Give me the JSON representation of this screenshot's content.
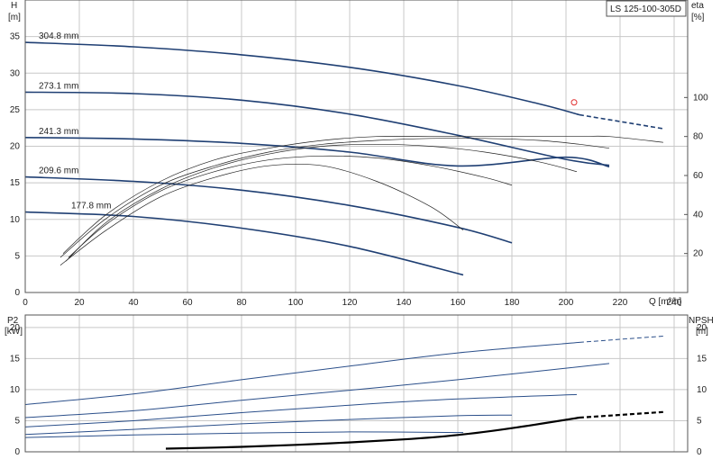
{
  "model_label": "LS 125-100-305D",
  "top_chart": {
    "y_left_label_1": "H",
    "y_left_label_2": "[m]",
    "y_right_label_1": "eta",
    "y_right_label_2": "[%]",
    "x_axis_unit": "Q [m³/h]",
    "x_ticks": [
      "0",
      "20",
      "40",
      "60",
      "80",
      "100",
      "120",
      "140",
      "160",
      "180",
      "200",
      "220",
      "240"
    ],
    "y_left_ticks": [
      "0",
      "5",
      "10",
      "15",
      "20",
      "25",
      "30",
      "35"
    ],
    "y_right_ticks": [
      "20",
      "40",
      "60",
      "80",
      "100"
    ]
  },
  "bottom_chart": {
    "y_left_label_1": "P2",
    "y_left_label_2": "[kW]",
    "y_right_label_1": "NPSH",
    "y_right_label_2": "[m]",
    "y_left_ticks": [
      "0",
      "5",
      "10",
      "15",
      "20"
    ],
    "y_right_ticks": [
      "0",
      "5",
      "10",
      "15",
      "20"
    ]
  },
  "colors": {
    "head": "#1f3f73",
    "power": "#2b4f8a",
    "efficiency": "#222222",
    "npsh": "#000000",
    "grid": "#c8c8c8",
    "duty_point": "#e03030"
  },
  "chart_data": [
    {
      "type": "line",
      "title": "LS 125-100-305D",
      "xlabel": "Q [m³/h]",
      "ylabel": "H [m]",
      "y2label": "eta [%]",
      "xlim": [
        0,
        245
      ],
      "ylim": [
        0,
        40
      ],
      "y2lim": [
        0,
        150
      ],
      "grid": true,
      "series": [
        {
          "name": "304.8 mm",
          "axis": "H",
          "x": [
            0,
            40,
            80,
            120,
            160,
            190,
            205
          ],
          "y": [
            34.2,
            33.6,
            32.5,
            30.8,
            28.3,
            25.8,
            24.3
          ],
          "dashed_x": [
            205,
            236
          ],
          "dashed_y": [
            24.3,
            22.4
          ]
        },
        {
          "name": "273.1 mm",
          "axis": "H",
          "x": [
            0,
            40,
            80,
            120,
            160,
            200,
            216
          ],
          "y": [
            27.4,
            27.2,
            26.3,
            24.4,
            21.5,
            18.2,
            17.4
          ]
        },
        {
          "name": "241.3 mm",
          "axis": "H",
          "x": [
            0,
            40,
            80,
            120,
            160,
            200,
            216
          ],
          "y": [
            21.2,
            21.0,
            20.4,
            19.2,
            17.3,
            18.5,
            17.2
          ]
        },
        {
          "name": "209.6 mm",
          "axis": "H",
          "x": [
            0,
            40,
            80,
            120,
            160,
            180
          ],
          "y": [
            15.8,
            15.2,
            14.0,
            11.9,
            8.9,
            6.8
          ]
        },
        {
          "name": "177.8 mm",
          "axis": "H",
          "x": [
            0,
            40,
            80,
            120,
            162
          ],
          "y": [
            11.0,
            10.4,
            8.8,
            6.3,
            2.4
          ]
        },
        {
          "name": "",
          "axis": "eta",
          "x": [
            13,
            30,
            50,
            70,
            90,
            110,
            130,
            150,
            170,
            190,
            205,
            216
          ],
          "y": [
            18,
            38,
            55,
            65,
            72,
            76,
            78,
            79,
            79,
            78,
            76,
            74
          ]
        },
        {
          "name": "",
          "axis": "eta",
          "x": [
            14,
            30,
            50,
            70,
            90,
            110,
            130,
            150,
            170,
            190,
            205,
            216,
            236
          ],
          "y": [
            20,
            40,
            57,
            68,
            74,
            78,
            80,
            80,
            80,
            80,
            80,
            80,
            77
          ]
        },
        {
          "name": "",
          "axis": "eta",
          "x": [
            15,
            30,
            50,
            70,
            90,
            110,
            130,
            150,
            170,
            190,
            204
          ],
          "y": [
            16,
            36,
            53,
            64,
            71,
            75,
            76,
            75,
            72,
            67,
            62
          ]
        },
        {
          "name": "",
          "axis": "eta",
          "x": [
            16,
            30,
            50,
            70,
            90,
            110,
            130,
            150,
            170,
            180
          ],
          "y": [
            18,
            35,
            52,
            62,
            68,
            70,
            69,
            65,
            59,
            55
          ]
        },
        {
          "name": "",
          "axis": "eta",
          "x": [
            13,
            30,
            50,
            70,
            90,
            110,
            130,
            150,
            162
          ],
          "y": [
            14,
            32,
            49,
            59,
            65,
            65,
            57,
            44,
            32
          ]
        }
      ],
      "duty_point": {
        "x": 203,
        "y": 26
      }
    },
    {
      "type": "line",
      "xlabel": "Q [m³/h]",
      "ylabel": "P2 [kW]",
      "y2label": "NPSH [m]",
      "xlim": [
        0,
        245
      ],
      "ylim": [
        0,
        22
      ],
      "y2lim": [
        0,
        22
      ],
      "grid": true,
      "series": [
        {
          "name": "304.8 mm",
          "axis": "P2",
          "x": [
            0,
            40,
            80,
            120,
            160,
            205
          ],
          "y": [
            7.6,
            9.3,
            11.6,
            13.8,
            15.9,
            17.6
          ],
          "dashed_x": [
            205,
            236
          ],
          "dashed_y": [
            17.6,
            18.6
          ]
        },
        {
          "name": "273.1 mm",
          "axis": "P2",
          "x": [
            0,
            40,
            80,
            120,
            160,
            216
          ],
          "y": [
            5.5,
            6.6,
            8.3,
            9.9,
            11.6,
            14.2
          ]
        },
        {
          "name": "241.3 mm",
          "axis": "P2",
          "x": [
            0,
            40,
            80,
            120,
            160,
            204
          ],
          "y": [
            4.0,
            5.0,
            6.3,
            7.5,
            8.5,
            9.2
          ]
        },
        {
          "name": "209.6 mm",
          "axis": "P2",
          "x": [
            0,
            40,
            80,
            120,
            160,
            180
          ],
          "y": [
            2.8,
            3.6,
            4.5,
            5.2,
            5.8,
            5.9
          ]
        },
        {
          "name": "177.8 mm",
          "axis": "P2",
          "x": [
            0,
            40,
            80,
            120,
            162
          ],
          "y": [
            2.3,
            2.7,
            3.0,
            3.2,
            3.1
          ]
        },
        {
          "name": "NPSH",
          "axis": "NPSH",
          "x": [
            52,
            80,
            110,
            140,
            160,
            180,
            205
          ],
          "y": [
            0.5,
            0.8,
            1.3,
            2.0,
            2.7,
            3.8,
            5.5
          ],
          "dashed_x": [
            205,
            236
          ],
          "dashed_y": [
            5.5,
            6.4
          ]
        }
      ]
    }
  ]
}
